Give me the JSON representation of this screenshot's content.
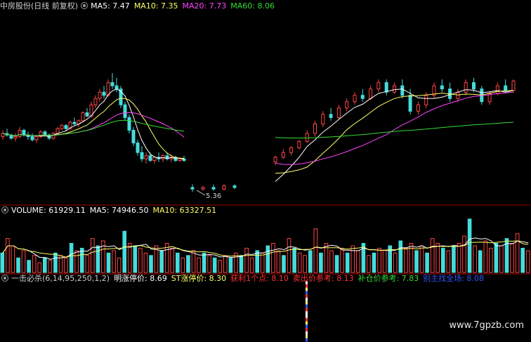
{
  "price_panel": {
    "title": "中房股份(日线 前复权)",
    "ma_items": [
      {
        "label": "MA5: 7.47",
        "color": "#ffffff"
      },
      {
        "label": "MA10: 7.35",
        "color": "#ffff66"
      },
      {
        "label": "MA20: 7.73",
        "color": "#ff44ff"
      },
      {
        "label": "MA60: 8.06",
        "color": "#33dd33"
      }
    ],
    "low_marker": "5.36"
  },
  "volume_panel": {
    "items": [
      {
        "label": "VOLUME: 61929.11",
        "color": "#ffffff"
      },
      {
        "label": "MA5: 74946.50",
        "color": "#ffffff"
      },
      {
        "label": "MA10: 63327.51",
        "color": "#ffff66"
      }
    ]
  },
  "indicator_panel": {
    "items": [
      {
        "label": "一击必杀(6,14,95,250,1,2)",
        "color": "#cccccc"
      },
      {
        "label": "明涨停价: 8.69",
        "color": "#ffffff"
      },
      {
        "label": "ST涨停价: 8.30",
        "color": "#ffff66"
      },
      {
        "label": "获利1个点: 8.10",
        "color": "#ff3333"
      },
      {
        "label": "卖出价参考: 8.13",
        "color": "#ff3333"
      },
      {
        "label": "补仓价参考: 7.83",
        "color": "#33dd33"
      },
      {
        "label": "别主找全场: 8.08",
        "color": "#3355ff"
      }
    ]
  },
  "watermark": "www.7gpzb.com",
  "chart_data": {
    "type": "candlestick",
    "title": "中房股份(日线 前复权)",
    "price_min_shown": 5.36,
    "moving_averages": {
      "MA5": 7.47,
      "MA10": 7.35,
      "MA20": 7.73,
      "MA60": 8.06
    },
    "volume": {
      "VOLUME": 61929.11,
      "MA5": 74946.5,
      "MA10": 63327.51
    },
    "candles": [
      [
        7.1,
        7.3,
        7.0,
        7.2
      ],
      [
        7.2,
        7.35,
        7.1,
        7.15
      ],
      [
        7.15,
        7.2,
        7.0,
        7.05
      ],
      [
        7.05,
        7.2,
        6.95,
        7.1
      ],
      [
        7.1,
        7.4,
        7.05,
        7.3
      ],
      [
        7.3,
        7.35,
        7.1,
        7.15
      ],
      [
        7.15,
        7.25,
        7.0,
        7.1
      ],
      [
        7.1,
        7.2,
        6.95,
        7.0
      ],
      [
        7.0,
        7.15,
        6.9,
        7.1
      ],
      [
        7.1,
        7.3,
        7.05,
        7.25
      ],
      [
        7.25,
        7.3,
        7.1,
        7.15
      ],
      [
        7.15,
        7.2,
        7.0,
        7.05
      ],
      [
        7.05,
        7.25,
        7.0,
        7.2
      ],
      [
        7.2,
        7.4,
        7.15,
        7.35
      ],
      [
        7.35,
        7.5,
        7.3,
        7.45
      ],
      [
        7.45,
        7.5,
        7.3,
        7.35
      ],
      [
        7.35,
        7.6,
        7.3,
        7.55
      ],
      [
        7.55,
        7.7,
        7.45,
        7.5
      ],
      [
        7.5,
        7.65,
        7.4,
        7.6
      ],
      [
        7.6,
        7.9,
        7.55,
        7.85
      ],
      [
        7.85,
        8.0,
        7.7,
        7.75
      ],
      [
        7.75,
        8.2,
        7.7,
        8.1
      ],
      [
        8.1,
        8.4,
        8.0,
        8.3
      ],
      [
        8.3,
        8.6,
        8.2,
        8.5
      ],
      [
        8.5,
        8.7,
        8.3,
        8.4
      ],
      [
        8.4,
        8.9,
        8.35,
        8.8
      ],
      [
        8.8,
        9.1,
        8.6,
        8.7
      ],
      [
        8.7,
        8.95,
        8.5,
        8.6
      ],
      [
        8.6,
        8.7,
        8.0,
        8.1
      ],
      [
        8.1,
        8.2,
        7.6,
        7.7
      ],
      [
        7.7,
        7.8,
        7.2,
        7.3
      ],
      [
        7.3,
        7.4,
        6.8,
        6.9
      ],
      [
        6.9,
        7.0,
        6.5,
        6.6
      ],
      [
        6.6,
        6.8,
        6.3,
        6.4
      ],
      [
        6.4,
        6.6,
        6.25,
        6.5
      ],
      [
        6.5,
        6.6,
        6.3,
        6.35
      ],
      [
        6.35,
        6.5,
        6.25,
        6.45
      ],
      [
        6.45,
        6.6,
        6.3,
        6.4
      ],
      [
        6.4,
        6.55,
        6.3,
        6.5
      ],
      [
        6.5,
        6.6,
        6.35,
        6.4
      ],
      [
        6.4,
        6.55,
        6.3,
        6.45
      ],
      [
        6.45,
        6.5,
        6.3,
        6.35
      ],
      [
        6.35,
        6.45,
        6.3,
        6.4
      ],
      [
        6.4,
        6.5,
        6.3,
        6.35
      ],
      [
        5.5,
        5.6,
        5.36,
        5.45
      ],
      [
        5.45,
        5.55,
        5.4,
        5.5
      ],
      [
        5.5,
        5.6,
        5.4,
        5.45
      ],
      [
        5.45,
        5.6,
        5.4,
        5.55
      ],
      [
        5.55,
        5.6,
        5.45,
        5.5
      ],
      [
        6.3,
        6.5,
        6.2,
        6.45
      ],
      [
        6.45,
        6.7,
        6.4,
        6.6
      ],
      [
        6.6,
        6.8,
        6.5,
        6.75
      ],
      [
        6.75,
        7.0,
        6.7,
        6.95
      ],
      [
        6.95,
        7.3,
        6.9,
        7.2
      ],
      [
        7.2,
        7.6,
        7.1,
        7.5
      ],
      [
        7.5,
        7.9,
        7.4,
        7.8
      ],
      [
        7.8,
        8.0,
        7.6,
        7.7
      ],
      [
        7.7,
        8.1,
        7.65,
        8.0
      ],
      [
        8.0,
        8.3,
        7.9,
        8.2
      ],
      [
        8.2,
        8.5,
        8.1,
        8.4
      ],
      [
        8.4,
        8.6,
        8.2,
        8.3
      ],
      [
        8.3,
        8.7,
        8.25,
        8.6
      ],
      [
        8.6,
        8.9,
        8.5,
        8.8
      ],
      [
        8.8,
        8.9,
        8.4,
        8.5
      ],
      [
        8.5,
        8.8,
        8.45,
        8.7
      ],
      [
        8.7,
        8.9,
        8.3,
        8.4
      ],
      [
        8.4,
        8.6,
        7.8,
        7.9
      ],
      [
        7.9,
        8.2,
        7.8,
        8.1
      ],
      [
        8.1,
        8.5,
        8.0,
        8.4
      ],
      [
        8.4,
        8.8,
        8.3,
        8.7
      ],
      [
        8.7,
        8.9,
        8.5,
        8.6
      ],
      [
        8.6,
        8.8,
        8.2,
        8.3
      ],
      [
        8.3,
        8.6,
        8.2,
        8.5
      ],
      [
        8.5,
        8.9,
        8.4,
        8.8
      ],
      [
        8.8,
        8.95,
        8.5,
        8.6
      ],
      [
        8.6,
        8.7,
        8.1,
        8.2
      ],
      [
        8.2,
        8.5,
        8.1,
        8.45
      ],
      [
        8.45,
        8.8,
        8.4,
        8.7
      ],
      [
        8.7,
        8.9,
        8.5,
        8.55
      ],
      [
        8.55,
        8.9,
        8.5,
        8.85
      ]
    ],
    "volume_bars": [
      40,
      70,
      55,
      30,
      45,
      25,
      35,
      20,
      30,
      25,
      40,
      35,
      30,
      60,
      45,
      50,
      35,
      70,
      55,
      65,
      40,
      45,
      30,
      85,
      60,
      55,
      50,
      40,
      35,
      55,
      45,
      60,
      50,
      40,
      30,
      35,
      45,
      30,
      40,
      35,
      30,
      25,
      35,
      30,
      40,
      35,
      50,
      30,
      45,
      40,
      55,
      60,
      45,
      35,
      70,
      50,
      40,
      35,
      45,
      90,
      40,
      60,
      45,
      35,
      50,
      40,
      55,
      45,
      60,
      35,
      40,
      50,
      45,
      55,
      40,
      65,
      50,
      60,
      45,
      55,
      40,
      70,
      60,
      50,
      45,
      55,
      60,
      75,
      110,
      55,
      45,
      65,
      50,
      60,
      55,
      70,
      60,
      80,
      50,
      45
    ]
  }
}
